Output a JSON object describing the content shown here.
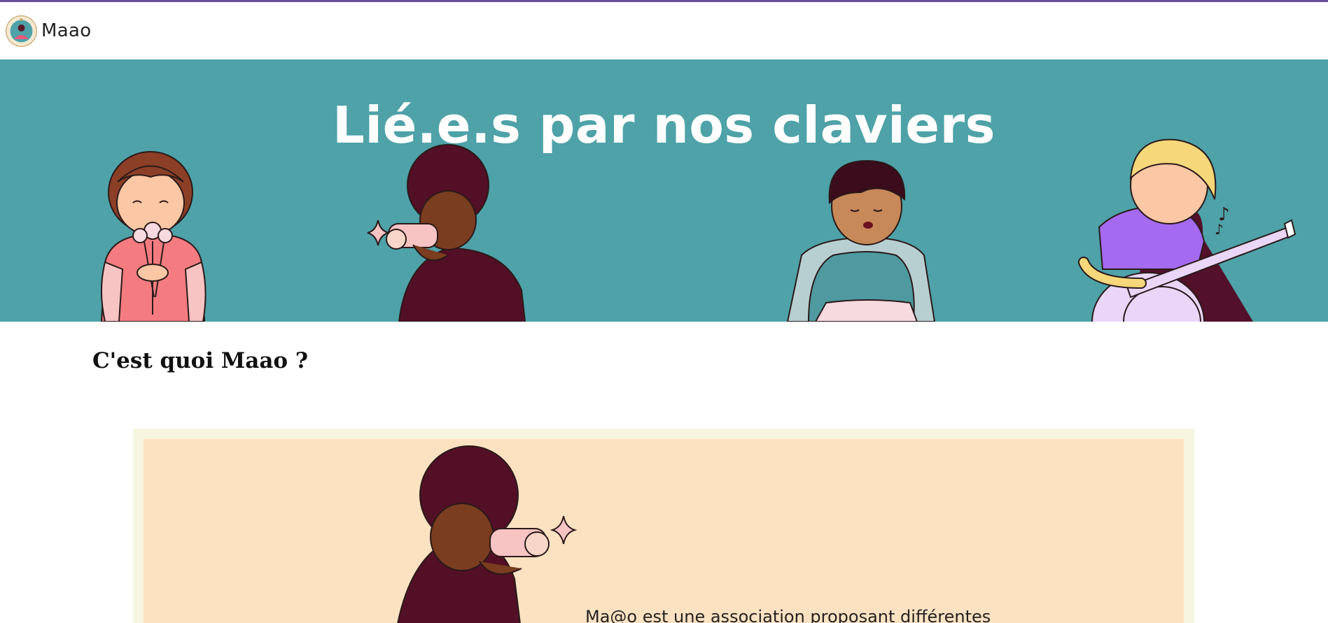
{
  "app": {
    "brand_name": "Maao",
    "logo_icon": "maao-logo-icon",
    "top_border_color": "#6b4f9a"
  },
  "hero": {
    "title": "Lié.e.s par nos claviers",
    "background_color": "#4ea2a8",
    "illustrations": [
      "girl-with-flowers-icon",
      "boy-with-binoculars-icon",
      "boy-reading-icon",
      "girl-with-guitar-icon"
    ]
  },
  "section": {
    "title": "C'est quoi Maao ?"
  },
  "card": {
    "text": "Ma@o est une association proposant différentes",
    "background_color": "#fde2c2",
    "border_color": "#f5f5e0",
    "illustration": "boy-with-binoculars-icon"
  }
}
